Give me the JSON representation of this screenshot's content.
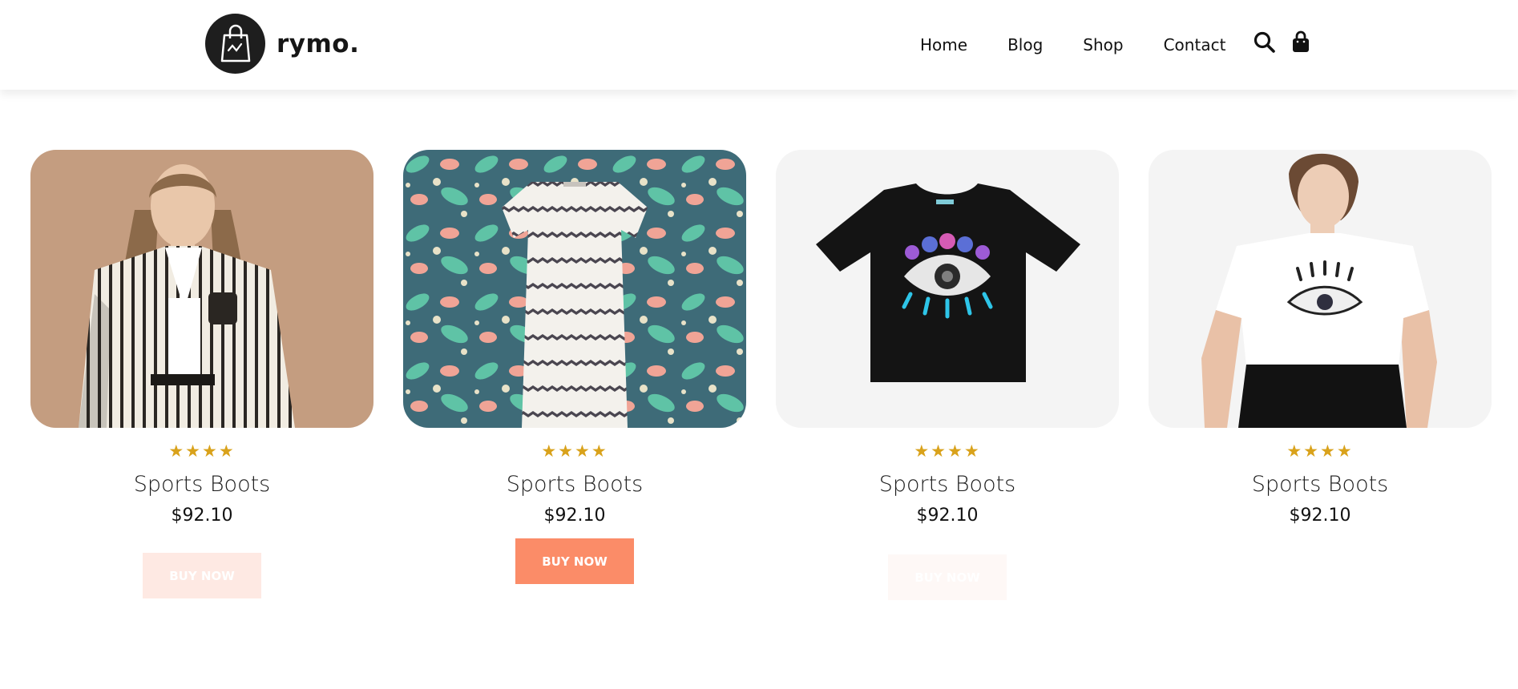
{
  "brand": {
    "name": "rymo."
  },
  "nav": {
    "items": [
      "Home",
      "Blog",
      "Shop",
      "Contact"
    ]
  },
  "icons": {
    "search": "search-icon",
    "bag": "shopping-bag-icon"
  },
  "colors": {
    "accent": "#fb8c68",
    "star": "#d9a21b",
    "logo_bg": "#1e1e1e"
  },
  "products": [
    {
      "stars": "★★★★",
      "rating": 4,
      "title": "Sports Boots",
      "price": "$92.10",
      "button": "BUY NOW",
      "image": "woman in striped blazer"
    },
    {
      "stars": "★★★★",
      "rating": 4,
      "title": "Sports Boots",
      "price": "$92.10",
      "button": "BUY NOW",
      "image": "striped knit dress on floral pattern"
    },
    {
      "stars": "★★★★",
      "rating": 4,
      "title": "Sports Boots",
      "price": "$92.10",
      "button": "BUY NOW",
      "image": "black t-shirt with eye print"
    },
    {
      "stars": "★★★★",
      "rating": 4,
      "title": "Sports Boots",
      "price": "$92.10",
      "button": "BUY NOW",
      "image": "woman in white eye t-shirt"
    }
  ]
}
